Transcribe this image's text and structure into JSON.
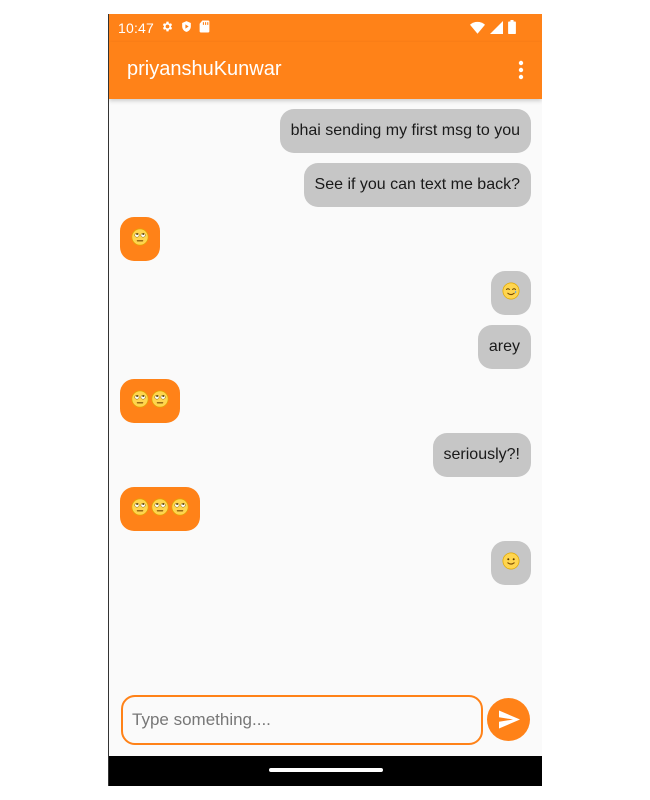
{
  "status_bar": {
    "time": "10:47",
    "left_icons": [
      "gear-icon",
      "play-protect-icon",
      "sd-card-icon"
    ],
    "right_icons": [
      "wifi-icon",
      "cell-signal-icon",
      "battery-icon"
    ]
  },
  "toolbar": {
    "title": "priyanshuKunwar",
    "menu_icon": "more-vert-icon"
  },
  "messages": [
    {
      "direction": "sent",
      "text": "bhai sending my first msg to you"
    },
    {
      "direction": "sent",
      "text": "See if you can text me back?"
    },
    {
      "direction": "received",
      "emoji": [
        "eye-roll-emoji"
      ]
    },
    {
      "direction": "sent",
      "emoji": [
        "smile-tear-emoji"
      ]
    },
    {
      "direction": "sent",
      "text": "arey"
    },
    {
      "direction": "received",
      "emoji": [
        "eye-roll-emoji",
        "eye-roll-emoji"
      ]
    },
    {
      "direction": "sent",
      "text": "seriously?!"
    },
    {
      "direction": "received",
      "emoji": [
        "eye-roll-emoji",
        "eye-roll-emoji",
        "eye-roll-emoji"
      ]
    },
    {
      "direction": "sent",
      "emoji": [
        "slight-smile-emoji"
      ]
    }
  ],
  "composer": {
    "placeholder": "Type something....",
    "value": "",
    "send_icon": "send-icon"
  },
  "colors": {
    "accent": "#ff8218",
    "sent_bubble": "#c6c6c6",
    "background": "#fafafa"
  }
}
